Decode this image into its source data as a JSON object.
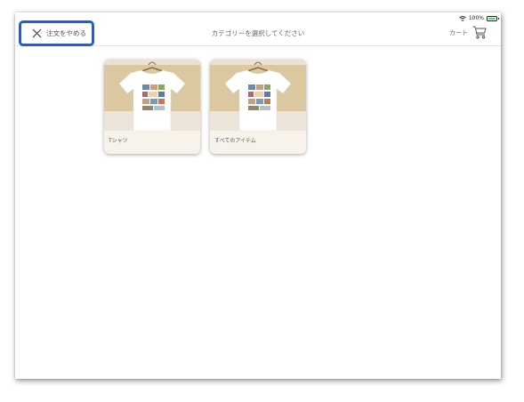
{
  "status_bar": {
    "battery": "100%"
  },
  "nav": {
    "cancel_label": "注文をやめる",
    "title": "カテゴリーを選択してください",
    "cart_label": "カート"
  },
  "categories": [
    {
      "label": "Tシャツ"
    },
    {
      "label": "すべてのアイテム"
    }
  ],
  "colors": {
    "highlight": "#1a5de8",
    "battery": "#4cd964"
  }
}
